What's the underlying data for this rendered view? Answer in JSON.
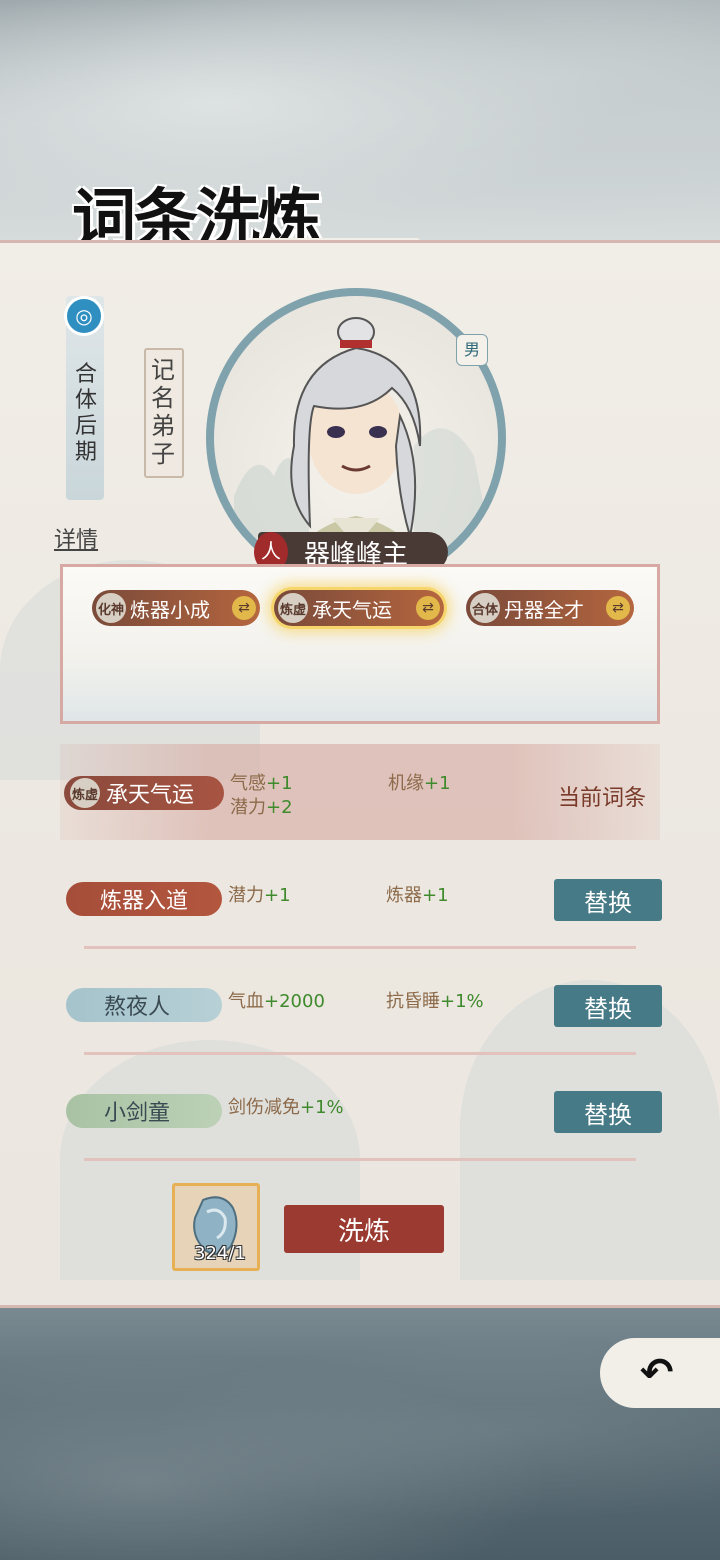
{
  "title": "词条洗炼",
  "character": {
    "realm": "合体后期",
    "rank": "记名弟子",
    "gender": "男",
    "name_icon": "人",
    "name": "器峰峰主",
    "detail_link": "详情"
  },
  "slots": [
    {
      "badge": "化神",
      "name": "炼器小成",
      "swap": "⇄"
    },
    {
      "badge": "炼虚",
      "name": "承天气运",
      "swap": "⇄"
    },
    {
      "badge": "合体",
      "name": "丹器全才",
      "swap": "⇄"
    }
  ],
  "current": {
    "badge": "炼虚",
    "name": "承天气运",
    "stat1_name": "气感",
    "stat1_value": "+1",
    "stat2_name": "潜力",
    "stat2_value": "+2",
    "stat3_name": "机缘",
    "stat3_value": "+1",
    "label": "当前词条"
  },
  "options": [
    {
      "name": "炼器入道",
      "stat1_name": "潜力",
      "stat1_value": "+1",
      "stat2_name": "炼器",
      "stat2_value": "+1",
      "button": "替换"
    },
    {
      "name": "熬夜人",
      "stat1_name": "气血",
      "stat1_value": "+2000",
      "stat2_name": "抗昏睡",
      "stat2_value": "+1%",
      "button": "替换"
    },
    {
      "name": "小剑童",
      "stat1_name": "剑伤减免",
      "stat1_value": "+1%",
      "button": "替换"
    }
  ],
  "item": {
    "count": "324/1"
  },
  "refine_button": "洗炼",
  "colors": {
    "accent_red": "#9a3a30",
    "teal_button": "#467a86",
    "gain_green": "#3f8a2c"
  }
}
